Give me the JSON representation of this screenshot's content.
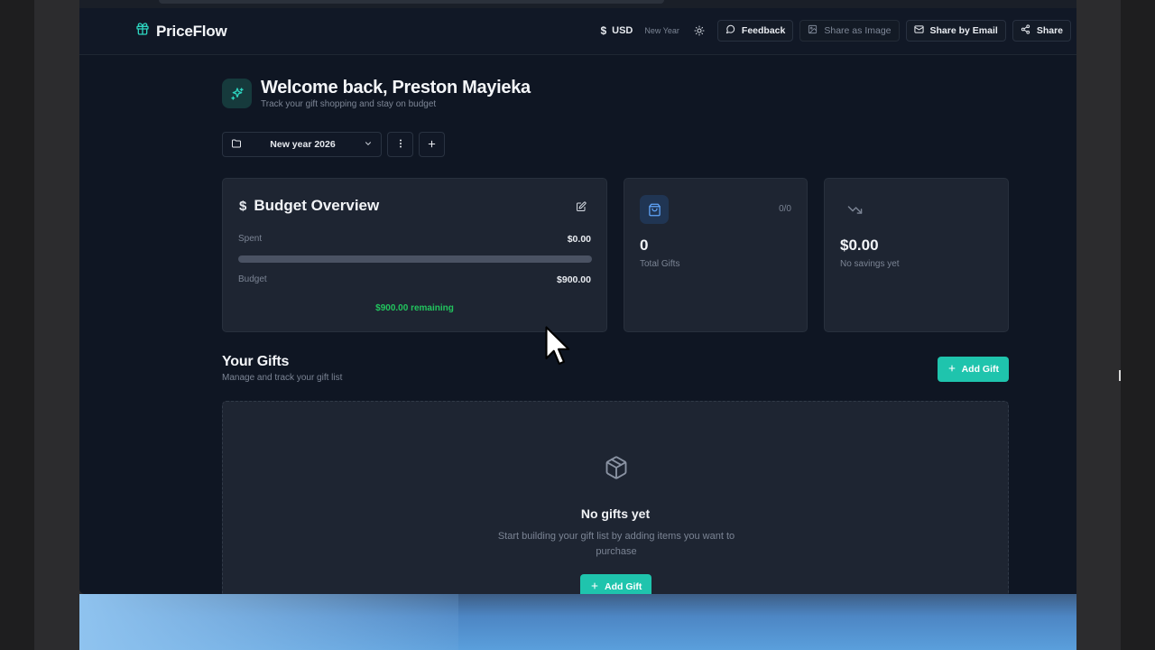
{
  "app": {
    "name": "PriceFlow"
  },
  "header": {
    "currency_symbol": "$",
    "currency": "USD",
    "event_label": "New Year",
    "buttons": {
      "feedback": "Feedback",
      "share_image": "Share as Image",
      "share_email": "Share by Email",
      "share": "Share"
    }
  },
  "welcome": {
    "title": "Welcome back, Preston Mayieka",
    "subtitle": "Track your gift shopping and stay on budget"
  },
  "event_selector": {
    "value": "New year 2026"
  },
  "budget": {
    "title": "Budget Overview",
    "spent_label": "Spent",
    "spent_value": "$0.00",
    "budget_label": "Budget",
    "budget_value": "$900.00",
    "progress_fraction": 0,
    "remaining": "$900.00 remaining"
  },
  "stats": {
    "gifts": {
      "count_badge": "0/0",
      "value": "0",
      "label": "Total Gifts"
    },
    "savings": {
      "value": "$0.00",
      "label": "No savings yet"
    }
  },
  "gifts": {
    "title": "Your Gifts",
    "subtitle": "Manage and track your gift list",
    "add_label": "Add Gift",
    "empty_title": "No gifts yet",
    "empty_subtitle": "Start building your gift list by adding items you want to purchase",
    "empty_add_label": "Add Gift"
  },
  "colors": {
    "accent": "#1fc4ad",
    "background": "#0f1623",
    "card": "#1e2532",
    "success": "#22c55e"
  },
  "icons": [
    "gift-icon",
    "dollar-icon",
    "sun-icon",
    "message-icon",
    "image-icon",
    "mail-icon",
    "share-icon",
    "sparkles-icon",
    "folder-icon",
    "chevron-down-icon",
    "more-vertical-icon",
    "plus-icon",
    "edit-icon",
    "shopping-bag-icon",
    "trending-down-icon",
    "package-icon",
    "mouse-cursor"
  ]
}
